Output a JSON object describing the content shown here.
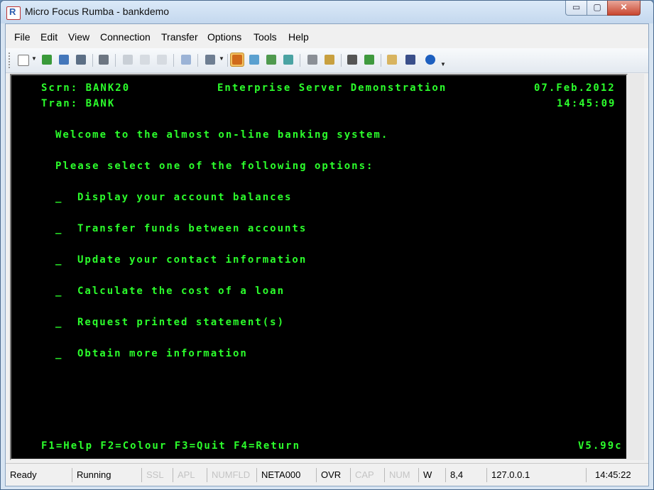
{
  "window": {
    "title": "Micro Focus Rumba - bankdemo",
    "minimize": "▭",
    "maximize": "▢",
    "close": "✕"
  },
  "menu": [
    "File",
    "Edit",
    "View",
    "Connection",
    "Transfer",
    "Options",
    "Tools",
    "Help"
  ],
  "toolbar": {
    "icons": [
      "new-session-icon",
      "open-icon",
      "properties-icon",
      "save-icon",
      "print-icon",
      "cut-icon",
      "copy-icon",
      "paste-icon",
      "undo-icon",
      "layout-icon",
      "connect-icon",
      "send-file-icon",
      "receive-file-icon",
      "transfer-icon",
      "settings-icon",
      "macro-icon",
      "record-icon",
      "play-icon",
      "edit-icon",
      "hotspots-icon",
      "help-icon"
    ]
  },
  "screen": {
    "scrn_label": "Scrn: BANK20",
    "tran_label": "Tran: BANK",
    "heading": "Enterprise Server Demonstration",
    "date": "07.Feb.2012",
    "time": "14:45:09",
    "welcome": "Welcome to the almost on-line banking system.",
    "prompt": "Please select one of the following options:",
    "field_marker": "_",
    "options": [
      "Display your account balances",
      "Transfer funds between accounts",
      "Update your contact information",
      "Calculate the cost of a loan",
      "Request printed statement(s)",
      "Obtain more information"
    ],
    "function_keys": "F1=Help F2=Colour F3=Quit F4=Return",
    "version": "V5.99c"
  },
  "status": {
    "ready": "Ready",
    "running": "Running",
    "ssl": "SSL",
    "apl": "APL",
    "numfld": "NUMFLD",
    "lu": "NETA000",
    "mode": "OVR",
    "cap": "CAP",
    "num": "NUM",
    "w": "W",
    "cursor": "8,4",
    "host": "127.0.0.1",
    "clock": "14:45:22"
  },
  "colors": {
    "terminal_text": "#2cff2c",
    "terminal_bg": "#000000"
  }
}
